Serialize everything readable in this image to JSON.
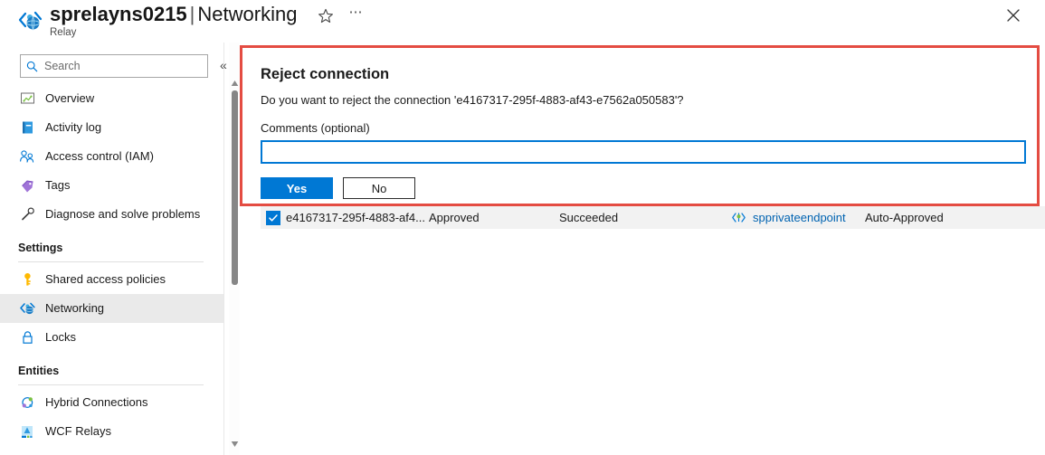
{
  "header": {
    "resource_icon": "relay-icon",
    "resource_name": "sprelayns0215",
    "separator": "|",
    "page_name": "Networking",
    "resource_type": "Relay",
    "favorite_icon": "star-icon",
    "more_icon": "ellipsis-icon",
    "close_icon": "close-icon"
  },
  "sidebar": {
    "search": {
      "placeholder": "Search",
      "value": "",
      "icon": "search-icon"
    },
    "collapse_icon": "chevron-double-left-icon",
    "items": [
      {
        "label": "Overview",
        "icon": "overview-icon",
        "selected": false
      },
      {
        "label": "Activity log",
        "icon": "activity-log-icon",
        "selected": false
      },
      {
        "label": "Access control (IAM)",
        "icon": "access-control-icon",
        "selected": false
      },
      {
        "label": "Tags",
        "icon": "tags-icon",
        "selected": false
      },
      {
        "label": "Diagnose and solve problems",
        "icon": "diagnose-icon",
        "selected": false
      }
    ],
    "groups": [
      {
        "title": "Settings",
        "items": [
          {
            "label": "Shared access policies",
            "icon": "key-icon",
            "selected": false
          },
          {
            "label": "Networking",
            "icon": "networking-icon",
            "selected": true
          },
          {
            "label": "Locks",
            "icon": "lock-icon",
            "selected": false
          }
        ]
      },
      {
        "title": "Entities",
        "items": [
          {
            "label": "Hybrid Connections",
            "icon": "hybrid-connections-icon",
            "selected": false
          },
          {
            "label": "WCF Relays",
            "icon": "wcf-relays-icon",
            "selected": false
          }
        ]
      }
    ],
    "scrollbar": {
      "up_icon": "scroll-up-arrow-icon",
      "down_icon": "scroll-down-arrow-icon"
    }
  },
  "dialog": {
    "title": "Reject connection",
    "question": "Do you want to reject the connection 'e4167317-295f-4883-af43-e7562a050583'?",
    "comments_label": "Comments (optional)",
    "comments_value": "",
    "comments_placeholder": "",
    "yes_label": "Yes",
    "no_label": "No"
  },
  "annotation": {
    "color": "#e44c42"
  },
  "table": {
    "rows": [
      {
        "checked": true,
        "check_icon": "checkmark-icon",
        "name": "e4167317-295f-4883-af4...",
        "connection_state": "Approved",
        "provisioning_state": "Succeeded",
        "endpoint_icon": "private-endpoint-icon",
        "endpoint": "spprivateendpoint",
        "description": "Auto-Approved"
      }
    ]
  },
  "colors": {
    "accent": "#0078d4",
    "link": "#0063b1",
    "annotation_red": "#e44c42",
    "selected_row": "#eaeaea",
    "table_row_bg": "#f2f2f2"
  }
}
